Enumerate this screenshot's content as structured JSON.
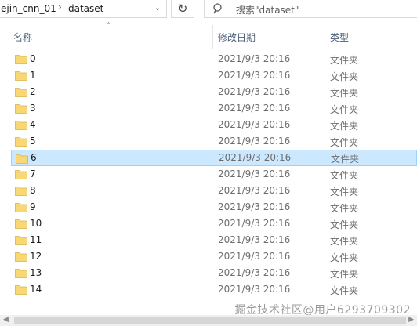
{
  "address": {
    "segments": [
      "ejin_cnn_01",
      "dataset"
    ],
    "separator": "›",
    "dropdown_icon": "chevron-down-icon",
    "refresh_icon": "refresh-icon"
  },
  "search": {
    "placeholder": "搜索\"dataset\"",
    "icon": "search-icon"
  },
  "columns": {
    "name": "名称",
    "date": "修改日期",
    "type": "类型"
  },
  "files": [
    {
      "name": "0",
      "date": "2021/9/3 20:16",
      "type": "文件夹"
    },
    {
      "name": "1",
      "date": "2021/9/3 20:16",
      "type": "文件夹"
    },
    {
      "name": "2",
      "date": "2021/9/3 20:16",
      "type": "文件夹"
    },
    {
      "name": "3",
      "date": "2021/9/3 20:16",
      "type": "文件夹"
    },
    {
      "name": "4",
      "date": "2021/9/3 20:16",
      "type": "文件夹"
    },
    {
      "name": "5",
      "date": "2021/9/3 20:16",
      "type": "文件夹"
    },
    {
      "name": "6",
      "date": "2021/9/3 20:16",
      "type": "文件夹",
      "selected": true
    },
    {
      "name": "7",
      "date": "2021/9/3 20:16",
      "type": "文件夹"
    },
    {
      "name": "8",
      "date": "2021/9/3 20:16",
      "type": "文件夹"
    },
    {
      "name": "9",
      "date": "2021/9/3 20:16",
      "type": "文件夹"
    },
    {
      "name": "10",
      "date": "2021/9/3 20:16",
      "type": "文件夹"
    },
    {
      "name": "11",
      "date": "2021/9/3 20:16",
      "type": "文件夹"
    },
    {
      "name": "12",
      "date": "2021/9/3 20:16",
      "type": "文件夹"
    },
    {
      "name": "13",
      "date": "2021/9/3 20:16",
      "type": "文件夹"
    },
    {
      "name": "14",
      "date": "2021/9/3 20:16",
      "type": "文件夹"
    }
  ],
  "watermark": "掘金技术社区@用户6293709302",
  "colors": {
    "selection_bg": "#cce8ff",
    "selection_border": "#99d1ff",
    "folder": "#f8d775",
    "header_text": "#4c607a"
  }
}
